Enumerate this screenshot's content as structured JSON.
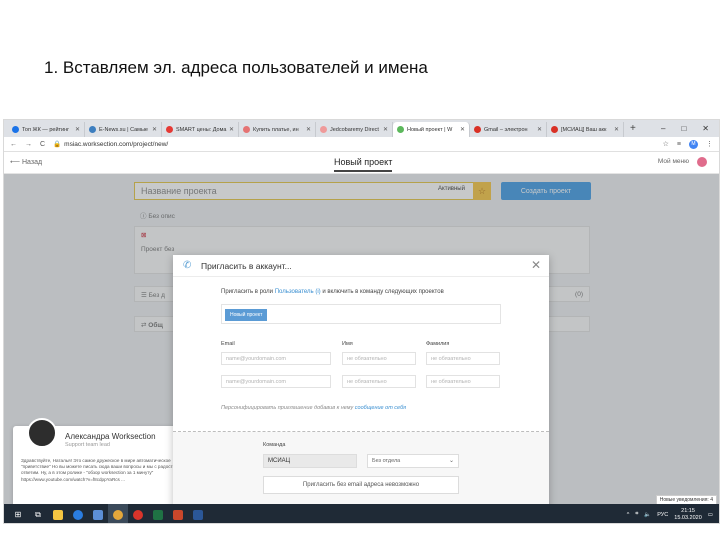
{
  "slide": {
    "heading": "1. Вставляем эл. адреса пользователей и имена"
  },
  "browser": {
    "tabs": [
      {
        "title": "Топ ЖК — рейтинг",
        "color": "#1a73e8",
        "active": false
      },
      {
        "title": "E-News.su | Самые",
        "color": "#3d7ebf",
        "active": false
      },
      {
        "title": "SMART цены: Дома",
        "color": "#e53935",
        "active": false
      },
      {
        "title": "Купить платье, ин",
        "color": "#e57373",
        "active": false
      },
      {
        "title": "Jedcobaremy Direct",
        "color": "#ef9a9a",
        "active": false
      },
      {
        "title": "Новый проект | W",
        "color": "#5cb85c",
        "active": true
      },
      {
        "title": "Gmail – электрон",
        "color": "#d93025",
        "active": false
      },
      {
        "title": "[МСИАЦ] Ваш акк",
        "color": "#d93025",
        "active": false
      }
    ],
    "new_tab_symbol": "+",
    "window_controls": [
      "–",
      "□",
      "✕"
    ],
    "url": "msiac.worksection.com/project/new/",
    "profile_letter": "M"
  },
  "app": {
    "back_label": "Назад",
    "title": "Новый проект",
    "my_menu": "Мой меню",
    "project_name_placeholder": "Название проекта",
    "status_label": "Активный",
    "create_button": "Создать проект",
    "row_no_desc": "Без опис",
    "row_project": "Проект без",
    "row_no_date": "Без д",
    "row_general": "Общ",
    "row_right_count": "(0)"
  },
  "chat": {
    "name": "Александра Worksection",
    "role": "Support team lead",
    "message": "Здравствуйте, Наталья! Это самое дружеское в мире автоматическое \"приветствие\" Но вы можете писать сюда ваши вопросы и мы с радостью вам ответим. Ну, а в этом ролике - \"обзор worksection за 1 минуту\" https://www.youtube.com/watch?v=f8cdppYaRcs ...",
    "badge": "1"
  },
  "modal": {
    "title": "Пригласить в аккаунт...",
    "invite_prefix": "Пригласить в роли ",
    "invite_role_link": "Пользователь (i)",
    "invite_suffix": " и включить в команду следующих проектов",
    "project_chip": "Новый проект",
    "col_email": "Email",
    "col_first": "Имя",
    "col_last": "Фамилия",
    "rows": [
      {
        "email": "name@yourdomain.com",
        "first": "не обязательно",
        "last": "не обязательно"
      },
      {
        "email": "name@yourdomain.com",
        "first": "не обязательно",
        "last": "не обязательно"
      }
    ],
    "personalize_text": "Персонифицировать приглашение добавив к нему ",
    "personalize_link": "сообщение от себя",
    "team_label": "Команда",
    "team_value": "МСИАЦ",
    "dept_value": "Без отдела",
    "invite_no_email": "Пригласить без email адреса невозможно"
  },
  "system": {
    "notification": "Новые уведомления: 4",
    "lang": "РУС",
    "time": "21:15",
    "date": "15.03.2020"
  }
}
